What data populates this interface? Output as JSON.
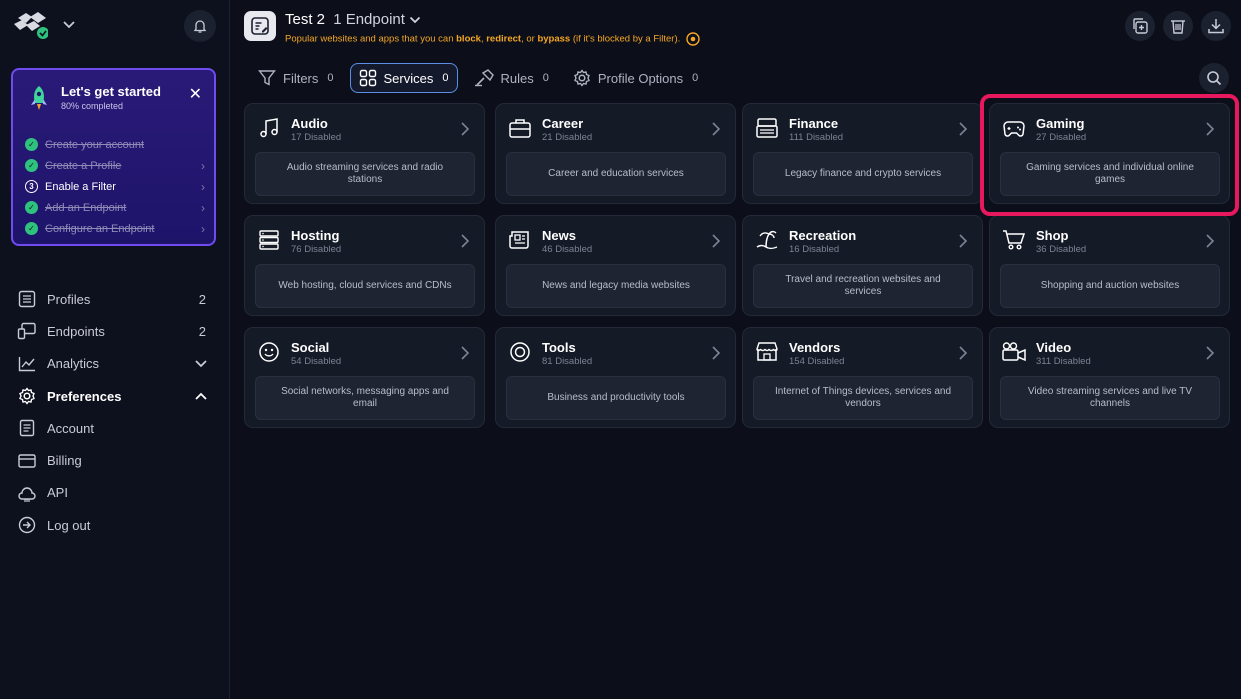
{
  "sidebar": {
    "getting_started": {
      "title": "Let's get started",
      "progress": "80% completed",
      "steps": [
        {
          "label": "Create your account",
          "done": true
        },
        {
          "label": "Create a Profile",
          "done": true
        },
        {
          "label": "Enable a Filter",
          "done": false,
          "number": "3"
        },
        {
          "label": "Add an Endpoint",
          "done": true
        },
        {
          "label": "Configure an Endpoint",
          "done": true
        }
      ]
    },
    "nav": [
      {
        "label": "Profiles",
        "icon": "profiles-icon",
        "count": "2"
      },
      {
        "label": "Endpoints",
        "icon": "endpoints-icon",
        "count": "2"
      },
      {
        "label": "Analytics",
        "icon": "analytics-icon"
      },
      {
        "label": "Preferences",
        "icon": "gear-icon"
      },
      {
        "label": "Account",
        "icon": "account-icon"
      },
      {
        "label": "Billing",
        "icon": "billing-icon"
      },
      {
        "label": "API",
        "icon": "api-icon"
      },
      {
        "label": "Log out",
        "icon": "logout-icon"
      }
    ]
  },
  "header": {
    "profile_name": "Test 2",
    "endpoint_count": "1 Endpoint",
    "desc_1": "Popular websites and apps that you can ",
    "desc_block": "block",
    "desc_2": ", ",
    "desc_redirect": "redirect",
    "desc_3": ", or ",
    "desc_bypass": "bypass",
    "desc_4": " (if it's blocked by a Filter)."
  },
  "tabs": [
    {
      "label": "Filters",
      "count": "0",
      "icon": "filter-icon"
    },
    {
      "label": "Services",
      "count": "0",
      "icon": "grid-icon"
    },
    {
      "label": "Rules",
      "count": "0",
      "icon": "rules-icon"
    },
    {
      "label": "Profile Options",
      "count": "0",
      "icon": "gear-icon"
    }
  ],
  "services": [
    {
      "name": "Audio",
      "disabled": "17 Disabled",
      "desc": "Audio streaming services and radio stations",
      "icon": "music-note-icon"
    },
    {
      "name": "Career",
      "disabled": "21 Disabled",
      "desc": "Career and education services",
      "icon": "briefcase-icon"
    },
    {
      "name": "Finance",
      "disabled": "111 Disabled",
      "desc": "Legacy finance and crypto services",
      "icon": "bank-icon"
    },
    {
      "name": "Gaming",
      "disabled": "27 Disabled",
      "desc": "Gaming services and individual online games",
      "icon": "gamepad-icon"
    },
    {
      "name": "Hosting",
      "disabled": "76 Disabled",
      "desc": "Web hosting, cloud services and CDNs",
      "icon": "server-icon"
    },
    {
      "name": "News",
      "disabled": "46 Disabled",
      "desc": "News and legacy media websites",
      "icon": "newspaper-icon"
    },
    {
      "name": "Recreation",
      "disabled": "16 Disabled",
      "desc": "Travel and recreation websites and services",
      "icon": "island-icon"
    },
    {
      "name": "Shop",
      "disabled": "36 Disabled",
      "desc": "Shopping and auction websites",
      "icon": "cart-icon"
    },
    {
      "name": "Social",
      "disabled": "54 Disabled",
      "desc": "Social networks, messaging apps and email",
      "icon": "smiley-icon"
    },
    {
      "name": "Tools",
      "disabled": "81 Disabled",
      "desc": "Business and productivity tools",
      "icon": "tools-icon"
    },
    {
      "name": "Vendors",
      "disabled": "154 Disabled",
      "desc": "Internet of Things devices, services and vendors",
      "icon": "store-icon"
    },
    {
      "name": "Video",
      "disabled": "311 Disabled",
      "desc": "Video streaming services and live TV channels",
      "icon": "video-camera-icon"
    }
  ],
  "colors": {
    "accent": "#6e4cf0",
    "warning": "#f5a623",
    "highlight": "#e8185f",
    "success": "#2ec27e"
  }
}
